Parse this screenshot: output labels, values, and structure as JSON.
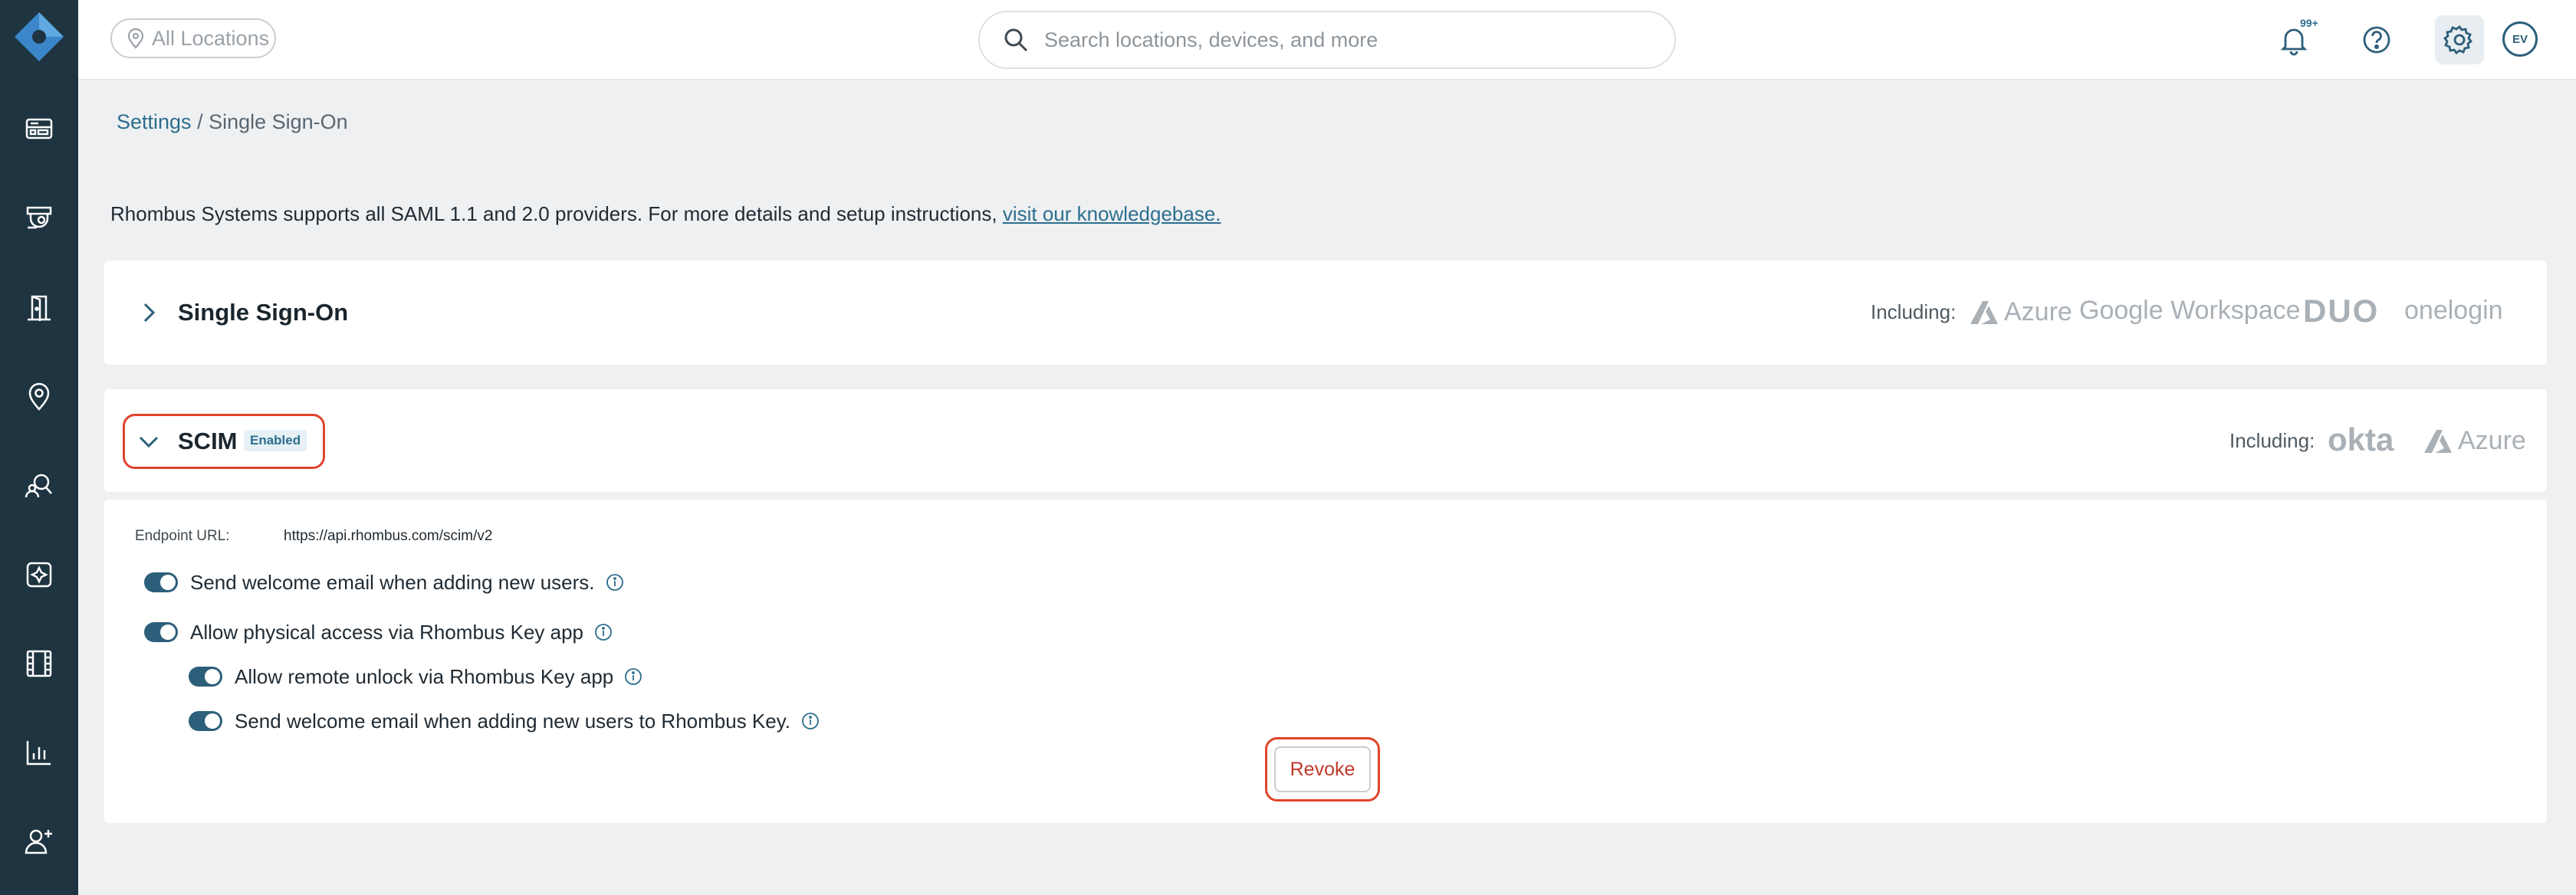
{
  "header": {
    "location_filter": "All Locations",
    "search_placeholder": "Search locations, devices, and more",
    "notification_badge": "99+",
    "avatar_initials": "EV"
  },
  "breadcrumb": {
    "parent": "Settings",
    "separator": " / ",
    "current": "Single Sign-On"
  },
  "intro": {
    "text": "Rhombus Systems supports all SAML 1.1 and 2.0 providers. For more details and setup instructions, ",
    "link": "visit our knowledgebase."
  },
  "sso_card": {
    "title": "Single Sign-On",
    "including_label": "Including:",
    "brands": [
      "Azure",
      "Google Workspace",
      "DUO",
      "onelogin"
    ]
  },
  "scim_card": {
    "title": "SCIM",
    "status_badge": "Enabled",
    "including_label": "Including:",
    "brands": [
      "okta",
      "Azure"
    ],
    "endpoint_label": "Endpoint URL:",
    "endpoint_value": "https://api.rhombus.com/scim/v2",
    "toggles": [
      {
        "label": "Send welcome email when adding new users.",
        "enabled": true
      },
      {
        "label": "Allow physical access via Rhombus Key app",
        "enabled": true
      },
      {
        "label": "Allow remote unlock via Rhombus Key app",
        "enabled": true
      },
      {
        "label": "Send welcome email when adding new users to Rhombus Key.",
        "enabled": true
      }
    ],
    "revoke_label": "Revoke"
  },
  "colors": {
    "sidebar": "#1e3440",
    "accent": "#2c6e8e",
    "highlight": "#e0442c",
    "revoke_text": "#c0392b"
  }
}
